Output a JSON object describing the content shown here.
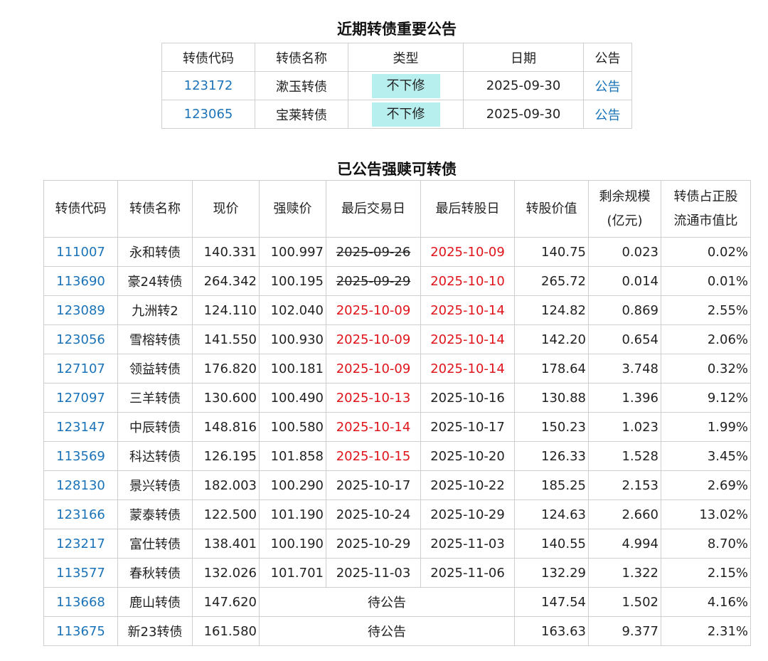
{
  "recent": {
    "title": "近期转债重要公告",
    "headers": [
      "转债代码",
      "转债名称",
      "类型",
      "日期",
      "公告"
    ],
    "rows": [
      {
        "code": "123172",
        "name": "漱玉转债",
        "type": "不下修",
        "date": "2025-09-30",
        "notice": "公告"
      },
      {
        "code": "123065",
        "name": "宝莱转债",
        "type": "不下修",
        "date": "2025-09-30",
        "notice": "公告"
      }
    ],
    "badge_color": "#b7eeee"
  },
  "redeem": {
    "title": "已公告强赎可转债",
    "headers": {
      "code": "转债代码",
      "name": "转债名称",
      "price": "现价",
      "redeem_price": "强赎价",
      "last_trade": "最后交易日",
      "last_convert": "最后转股日",
      "convert_value": "转股价值",
      "remaining_l1": "剩余规模",
      "remaining_l2": "(亿元)",
      "ratio_l1": "转债占正股",
      "ratio_l2": "流通市值比"
    },
    "rows": [
      {
        "code": "111007",
        "name": "永和转债",
        "price": "140.331",
        "redeem_price": "100.997",
        "last_trade": "2025-09-26",
        "last_convert": "2025-10-09",
        "convert_value": "140.75",
        "remaining": "0.023",
        "ratio": "0.02%"
      },
      {
        "code": "113690",
        "name": "豪24转债",
        "price": "264.342",
        "redeem_price": "100.195",
        "last_trade": "2025-09-29",
        "last_convert": "2025-10-10",
        "convert_value": "265.72",
        "remaining": "0.014",
        "ratio": "0.01%"
      },
      {
        "code": "123089",
        "name": "九洲转2",
        "price": "124.110",
        "redeem_price": "102.040",
        "last_trade": "2025-10-09",
        "last_convert": "2025-10-14",
        "convert_value": "124.82",
        "remaining": "0.869",
        "ratio": "2.55%"
      },
      {
        "code": "123056",
        "name": "雪榕转债",
        "price": "141.550",
        "redeem_price": "100.930",
        "last_trade": "2025-10-09",
        "last_convert": "2025-10-14",
        "convert_value": "142.20",
        "remaining": "0.654",
        "ratio": "2.06%"
      },
      {
        "code": "127107",
        "name": "领益转债",
        "price": "176.820",
        "redeem_price": "100.181",
        "last_trade": "2025-10-09",
        "last_convert": "2025-10-14",
        "convert_value": "178.64",
        "remaining": "3.748",
        "ratio": "0.32%"
      },
      {
        "code": "127097",
        "name": "三羊转债",
        "price": "130.600",
        "redeem_price": "100.490",
        "last_trade": "2025-10-13",
        "last_convert": "2025-10-16",
        "convert_value": "130.88",
        "remaining": "1.396",
        "ratio": "9.12%"
      },
      {
        "code": "123147",
        "name": "中辰转债",
        "price": "148.816",
        "redeem_price": "100.580",
        "last_trade": "2025-10-14",
        "last_convert": "2025-10-17",
        "convert_value": "150.23",
        "remaining": "1.023",
        "ratio": "1.99%"
      },
      {
        "code": "113569",
        "name": "科达转债",
        "price": "126.195",
        "redeem_price": "101.858",
        "last_trade": "2025-10-15",
        "last_convert": "2025-10-20",
        "convert_value": "126.33",
        "remaining": "1.528",
        "ratio": "3.45%"
      },
      {
        "code": "128130",
        "name": "景兴转债",
        "price": "182.003",
        "redeem_price": "100.290",
        "last_trade": "2025-10-17",
        "last_convert": "2025-10-22",
        "convert_value": "185.25",
        "remaining": "2.153",
        "ratio": "2.69%"
      },
      {
        "code": "123166",
        "name": "蒙泰转债",
        "price": "122.500",
        "redeem_price": "101.190",
        "last_trade": "2025-10-24",
        "last_convert": "2025-10-29",
        "convert_value": "124.63",
        "remaining": "2.660",
        "ratio": "13.02%"
      },
      {
        "code": "123217",
        "name": "富仕转债",
        "price": "138.401",
        "redeem_price": "100.190",
        "last_trade": "2025-10-29",
        "last_convert": "2025-11-03",
        "convert_value": "140.55",
        "remaining": "4.994",
        "ratio": "8.70%"
      },
      {
        "code": "113577",
        "name": "春秋转债",
        "price": "132.026",
        "redeem_price": "101.701",
        "last_trade": "2025-11-03",
        "last_convert": "2025-11-06",
        "convert_value": "132.29",
        "remaining": "1.322",
        "ratio": "2.15%"
      }
    ],
    "pending_rows": [
      {
        "code": "113668",
        "name": "鹿山转债",
        "price": "147.620",
        "status": "待公告",
        "convert_value": "147.54",
        "remaining": "1.502",
        "ratio": "4.16%"
      },
      {
        "code": "113675",
        "name": "新23转债",
        "price": "161.580",
        "status": "待公告",
        "convert_value": "163.63",
        "remaining": "9.377",
        "ratio": "2.31%"
      }
    ],
    "red_last_trade": [
      "2025-10-09",
      "2025-10-13",
      "2025-10-14",
      "2025-10-15"
    ],
    "red_last_convert": [
      "2025-10-09",
      "2025-10-10",
      "2025-10-14"
    ],
    "struck_last_trade": [
      "2025-09-26",
      "2025-09-29"
    ],
    "link_color": "#1a73b8",
    "highlight_color": "#e0141b"
  }
}
